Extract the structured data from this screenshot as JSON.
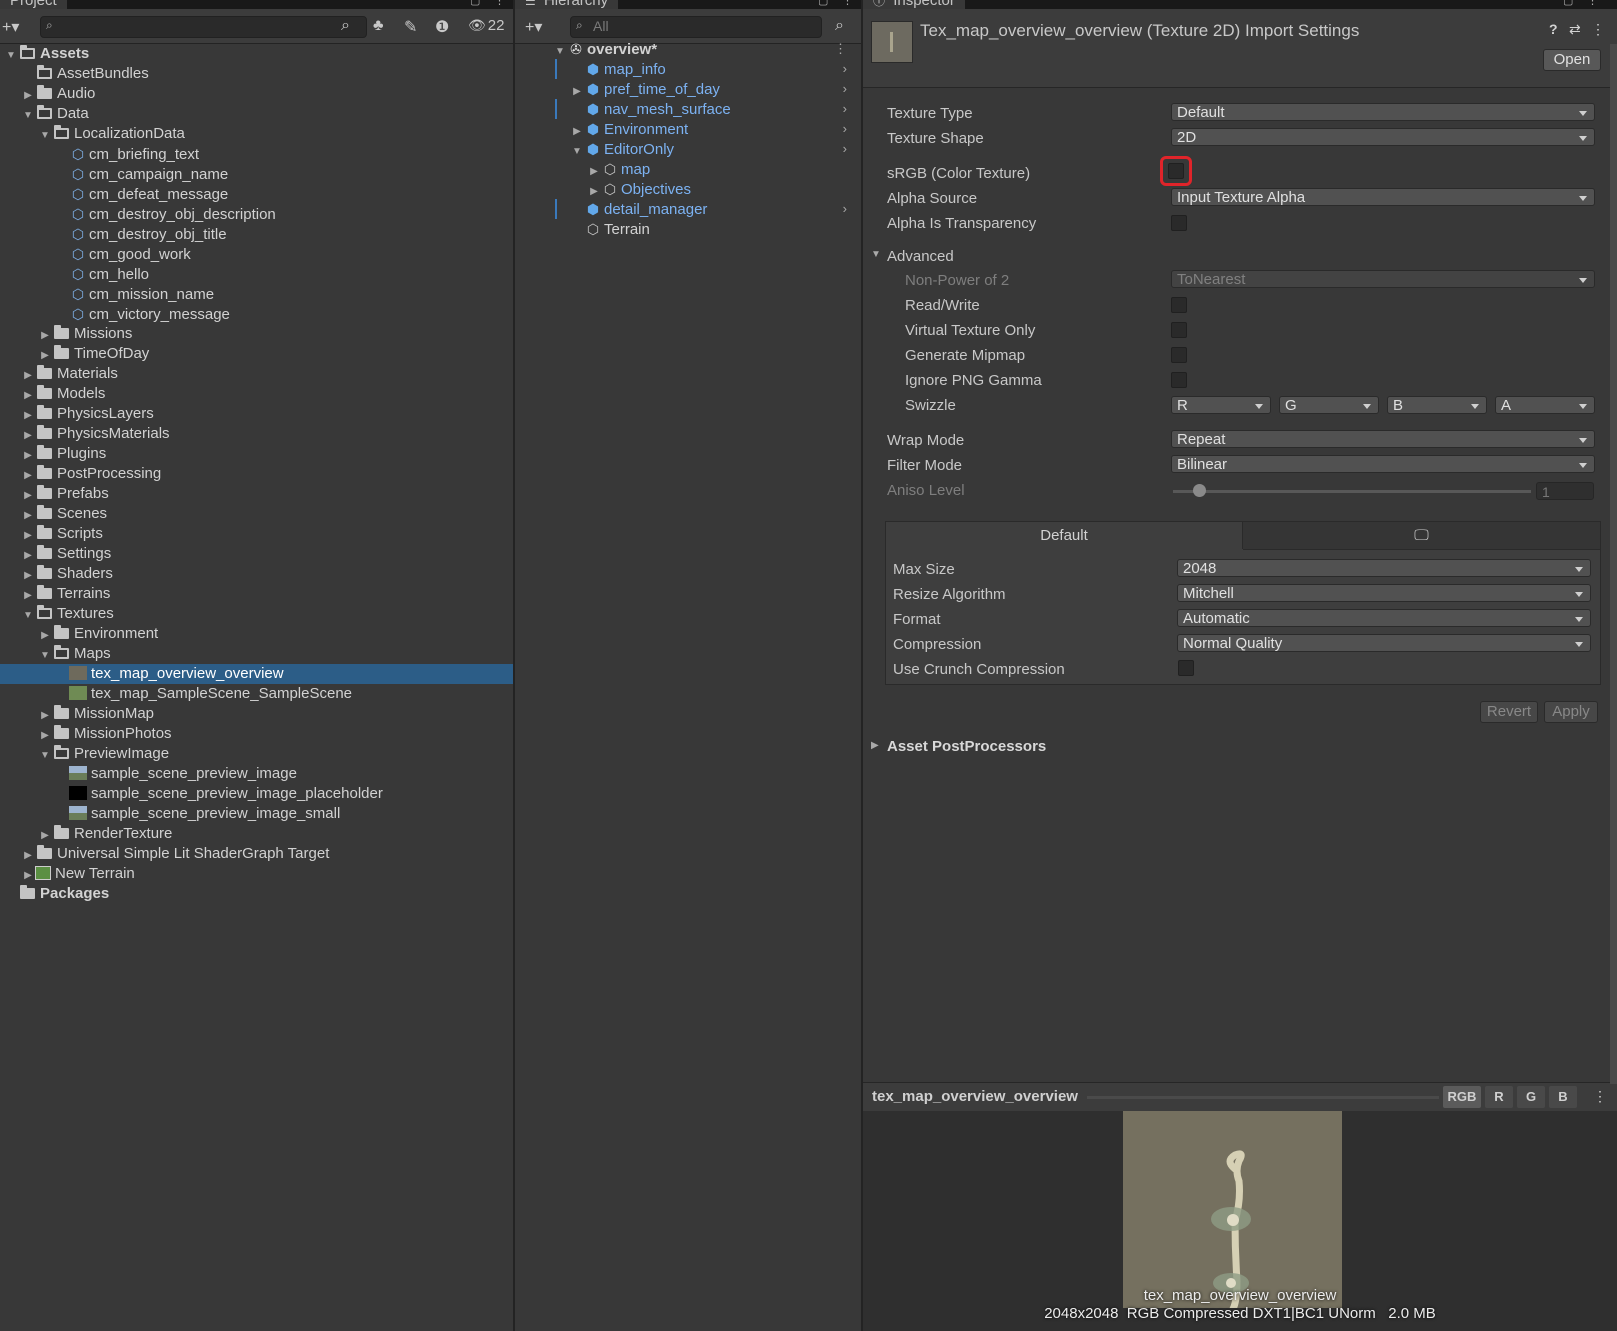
{
  "project": {
    "tab": "Project",
    "hidden_count": "22",
    "rows": [
      {
        "label": "Assets",
        "depth": 0,
        "arrow": "down",
        "icon": "folder-open",
        "bold": true
      },
      {
        "label": "AssetBundles",
        "depth": 1,
        "arrow": "",
        "icon": "folder-outline"
      },
      {
        "label": "Audio",
        "depth": 1,
        "arrow": "right",
        "icon": "folder"
      },
      {
        "label": "Data",
        "depth": 1,
        "arrow": "down",
        "icon": "folder-open"
      },
      {
        "label": "LocalizationData",
        "depth": 2,
        "arrow": "down",
        "icon": "folder-open"
      },
      {
        "label": "cm_briefing_text",
        "depth": 3,
        "arrow": "",
        "icon": "localization"
      },
      {
        "label": "cm_campaign_name",
        "depth": 3,
        "arrow": "",
        "icon": "localization"
      },
      {
        "label": "cm_defeat_message",
        "depth": 3,
        "arrow": "",
        "icon": "localization"
      },
      {
        "label": "cm_destroy_obj_description",
        "depth": 3,
        "arrow": "",
        "icon": "localization"
      },
      {
        "label": "cm_destroy_obj_title",
        "depth": 3,
        "arrow": "",
        "icon": "localization"
      },
      {
        "label": "cm_good_work",
        "depth": 3,
        "arrow": "",
        "icon": "localization"
      },
      {
        "label": "cm_hello",
        "depth": 3,
        "arrow": "",
        "icon": "localization"
      },
      {
        "label": "cm_mission_name",
        "depth": 3,
        "arrow": "",
        "icon": "localization"
      },
      {
        "label": "cm_victory_message",
        "depth": 3,
        "arrow": "",
        "icon": "localization"
      },
      {
        "label": "Missions",
        "depth": 2,
        "arrow": "right",
        "icon": "folder"
      },
      {
        "label": "TimeOfDay",
        "depth": 2,
        "arrow": "right",
        "icon": "folder"
      },
      {
        "label": "Materials",
        "depth": 1,
        "arrow": "right",
        "icon": "folder"
      },
      {
        "label": "Models",
        "depth": 1,
        "arrow": "right",
        "icon": "folder"
      },
      {
        "label": "PhysicsLayers",
        "depth": 1,
        "arrow": "right",
        "icon": "folder"
      },
      {
        "label": "PhysicsMaterials",
        "depth": 1,
        "arrow": "right",
        "icon": "folder"
      },
      {
        "label": "Plugins",
        "depth": 1,
        "arrow": "right",
        "icon": "folder"
      },
      {
        "label": "PostProcessing",
        "depth": 1,
        "arrow": "right",
        "icon": "folder"
      },
      {
        "label": "Prefabs",
        "depth": 1,
        "arrow": "right",
        "icon": "folder"
      },
      {
        "label": "Scenes",
        "depth": 1,
        "arrow": "right",
        "icon": "folder"
      },
      {
        "label": "Scripts",
        "depth": 1,
        "arrow": "right",
        "icon": "folder"
      },
      {
        "label": "Settings",
        "depth": 1,
        "arrow": "right",
        "icon": "folder"
      },
      {
        "label": "Shaders",
        "depth": 1,
        "arrow": "right",
        "icon": "folder"
      },
      {
        "label": "Terrains",
        "depth": 1,
        "arrow": "right",
        "icon": "folder"
      },
      {
        "label": "Textures",
        "depth": 1,
        "arrow": "down",
        "icon": "folder-open"
      },
      {
        "label": "Environment",
        "depth": 2,
        "arrow": "right",
        "icon": "folder"
      },
      {
        "label": "Maps",
        "depth": 2,
        "arrow": "down",
        "icon": "folder-open"
      },
      {
        "label": "tex_map_overview_overview",
        "depth": 3,
        "arrow": "",
        "icon": "texture-map",
        "selected": true
      },
      {
        "label": "tex_map_SampleScene_SampleScene",
        "depth": 3,
        "arrow": "",
        "icon": "texture-green"
      },
      {
        "label": "MissionMap",
        "depth": 2,
        "arrow": "right",
        "icon": "folder"
      },
      {
        "label": "MissionPhotos",
        "depth": 2,
        "arrow": "right",
        "icon": "folder"
      },
      {
        "label": "PreviewImage",
        "depth": 2,
        "arrow": "down",
        "icon": "folder-open"
      },
      {
        "label": "sample_scene_preview_image",
        "depth": 3,
        "arrow": "",
        "icon": "texture-landscape"
      },
      {
        "label": "sample_scene_preview_image_placeholder",
        "depth": 3,
        "arrow": "",
        "icon": "texture-black"
      },
      {
        "label": "sample_scene_preview_image_small",
        "depth": 3,
        "arrow": "",
        "icon": "texture-landscape"
      },
      {
        "label": "RenderTexture",
        "depth": 2,
        "arrow": "right",
        "icon": "folder"
      },
      {
        "label": "Universal Simple Lit ShaderGraph Target",
        "depth": 1,
        "arrow": "right",
        "icon": "folder"
      },
      {
        "label": "New Terrain",
        "depth": 1,
        "arrow": "right",
        "icon": "terrain"
      },
      {
        "label": "Packages",
        "depth": 0,
        "arrow": "",
        "icon": "folder",
        "bold": true
      }
    ]
  },
  "hierarchy": {
    "tab": "Hierarchy",
    "search_placeholder": "All",
    "rows": [
      {
        "label": "overview*",
        "depth": 0,
        "arrow": "down",
        "icon": "unity-scene",
        "bold": true,
        "color": "white"
      },
      {
        "label": "map_info",
        "depth": 1,
        "arrow": "",
        "icon": "prefab",
        "color": "blue",
        "chev": true,
        "mark": true
      },
      {
        "label": "pref_time_of_day",
        "depth": 1,
        "arrow": "right",
        "icon": "prefab",
        "color": "blue",
        "chev": true
      },
      {
        "label": "nav_mesh_surface",
        "depth": 1,
        "arrow": "",
        "icon": "prefab",
        "color": "blue",
        "chev": true,
        "mark": true
      },
      {
        "label": "Environment",
        "depth": 1,
        "arrow": "right",
        "icon": "prefab",
        "color": "blue",
        "chev": true
      },
      {
        "label": "EditorOnly",
        "depth": 1,
        "arrow": "down",
        "icon": "prefab",
        "color": "blue",
        "chev": true
      },
      {
        "label": "map",
        "depth": 2,
        "arrow": "right",
        "icon": "gameobject",
        "color": "blue"
      },
      {
        "label": "Objectives",
        "depth": 2,
        "arrow": "right",
        "icon": "gameobject",
        "color": "blue"
      },
      {
        "label": "detail_manager",
        "depth": 1,
        "arrow": "",
        "icon": "prefab",
        "color": "blue",
        "chev": true,
        "mark": true
      },
      {
        "label": "Terrain",
        "depth": 1,
        "arrow": "",
        "icon": "gameobject",
        "color": "white"
      }
    ]
  },
  "inspector": {
    "tab": "Inspector",
    "title": "Tex_map_overview_overview (Texture 2D) Import Settings",
    "open_label": "Open",
    "texture_type": {
      "label": "Texture Type",
      "value": "Default"
    },
    "texture_shape": {
      "label": "Texture Shape",
      "value": "2D"
    },
    "srgb": {
      "label": "sRGB (Color Texture)"
    },
    "alpha_source": {
      "label": "Alpha Source",
      "value": "Input Texture Alpha"
    },
    "alpha_transparency": {
      "label": "Alpha Is Transparency"
    },
    "advanced": {
      "label": "Advanced"
    },
    "npot": {
      "label": "Non-Power of 2",
      "value": "ToNearest"
    },
    "read_write": {
      "label": "Read/Write"
    },
    "virtual_texture": {
      "label": "Virtual Texture Only"
    },
    "mipmap": {
      "label": "Generate Mipmap"
    },
    "png_gamma": {
      "label": "Ignore PNG Gamma"
    },
    "swizzle": {
      "label": "Swizzle",
      "r": "R",
      "g": "G",
      "b": "B",
      "a": "A"
    },
    "wrap_mode": {
      "label": "Wrap Mode",
      "value": "Repeat"
    },
    "filter_mode": {
      "label": "Filter Mode",
      "value": "Bilinear"
    },
    "aniso": {
      "label": "Aniso Level",
      "value": "1"
    },
    "platform": {
      "default_tab": "Default",
      "max_size": {
        "label": "Max Size",
        "value": "2048"
      },
      "resize": {
        "label": "Resize Algorithm",
        "value": "Mitchell"
      },
      "format": {
        "label": "Format",
        "value": "Automatic"
      },
      "compression": {
        "label": "Compression",
        "value": "Normal Quality"
      },
      "crunch": {
        "label": "Use Crunch Compression"
      }
    },
    "revert_label": "Revert",
    "apply_label": "Apply",
    "postprocessors": "Asset PostProcessors",
    "preview": {
      "name": "tex_map_overview_overview",
      "channels": [
        "RGB",
        "R",
        "G",
        "B"
      ],
      "caption": "tex_map_overview_overview",
      "info": "2048x2048  RGB Compressed DXT1|BC1 UNorm   2.0 MB"
    }
  },
  "colors": {
    "selection": "#2c5d87",
    "highlight_ring": "#e0242a",
    "prefab_blue": "#7cb2f2"
  }
}
